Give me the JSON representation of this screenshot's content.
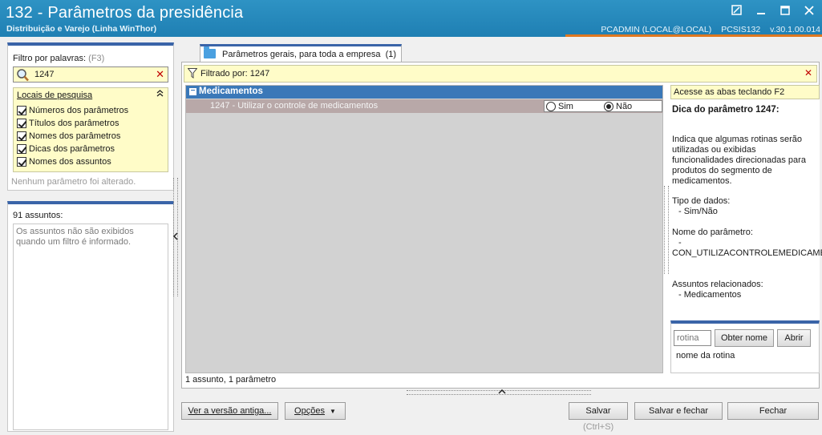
{
  "window": {
    "title": "132 - Parâmetros da presidência",
    "subtitle": "Distribuição e Varejo (Linha WinThor)",
    "user": "PCADMIN (LOCAL@LOCAL)",
    "program": "PCSIS132",
    "version": "v.30.1.00.014",
    "controls": [
      "restore-icon",
      "minimize-icon",
      "maximize-icon",
      "close-icon"
    ]
  },
  "filter": {
    "label": "Filtro por palavras:",
    "shortcut": "(F3)",
    "value": "1247",
    "clear_glyph": "✕",
    "locais_title": "Locais de pesquisa",
    "locais": [
      {
        "label": "Números dos parâmetros",
        "checked": true
      },
      {
        "label": "Títulos dos parâmetros",
        "checked": true
      },
      {
        "label": "Nomes dos parâmetros",
        "checked": true
      },
      {
        "label": "Dicas dos parâmetros",
        "checked": true
      },
      {
        "label": "Nomes dos assuntos",
        "checked": true
      }
    ],
    "status": "Nenhum parâmetro foi alterado."
  },
  "assuntos": {
    "count_label": "91 assuntos:",
    "message": "Os assuntos não são exibidos quando um filtro é informado."
  },
  "tab": {
    "label": "Parâmetros gerais, para toda a empresa",
    "count": "(1)"
  },
  "filter_bar": {
    "text": "Filtrado por: 1247",
    "close_glyph": "✕"
  },
  "grid": {
    "group_title": "Medicamentos",
    "group_toggle": "−",
    "row_label": "1247 - Utilizar o controle de medicamentos",
    "options": [
      {
        "label": "Sim",
        "selected": false
      },
      {
        "label": "Não",
        "selected": true
      }
    ],
    "status": "1 assunto, 1 parâmetro"
  },
  "tip": {
    "access_hint": "Acesse as abas teclando F2",
    "title": "Dica do parâmetro 1247:",
    "text": "Indica que algumas rotinas serão utilizadas ou exibidas funcionalidades direcionadas para produtos do segmento de medicamentos.",
    "data_type_label": "Tipo de dados:",
    "data_type_value": "- Sim/Não",
    "param_name_label": "Nome do parâmetro:",
    "param_name_dash": "-",
    "param_name_value": "CON_UTILIZACONTROLEMEDICAMEN",
    "subjects_label": "Assuntos relacionados:",
    "subjects_value": "- Medicamentos",
    "rotina_placeholder": "rotina",
    "get_name_label": "Obter nome",
    "open_label": "Abrir",
    "rotina_name_label": "nome da rotina"
  },
  "footer": {
    "old_version_label": "Ver a versão antiga...",
    "options_label": "Opções",
    "save_label": "Salvar",
    "save_hint": "(Ctrl+S)",
    "save_close_label": "Salvar e fechar",
    "close_label": "Fechar"
  }
}
